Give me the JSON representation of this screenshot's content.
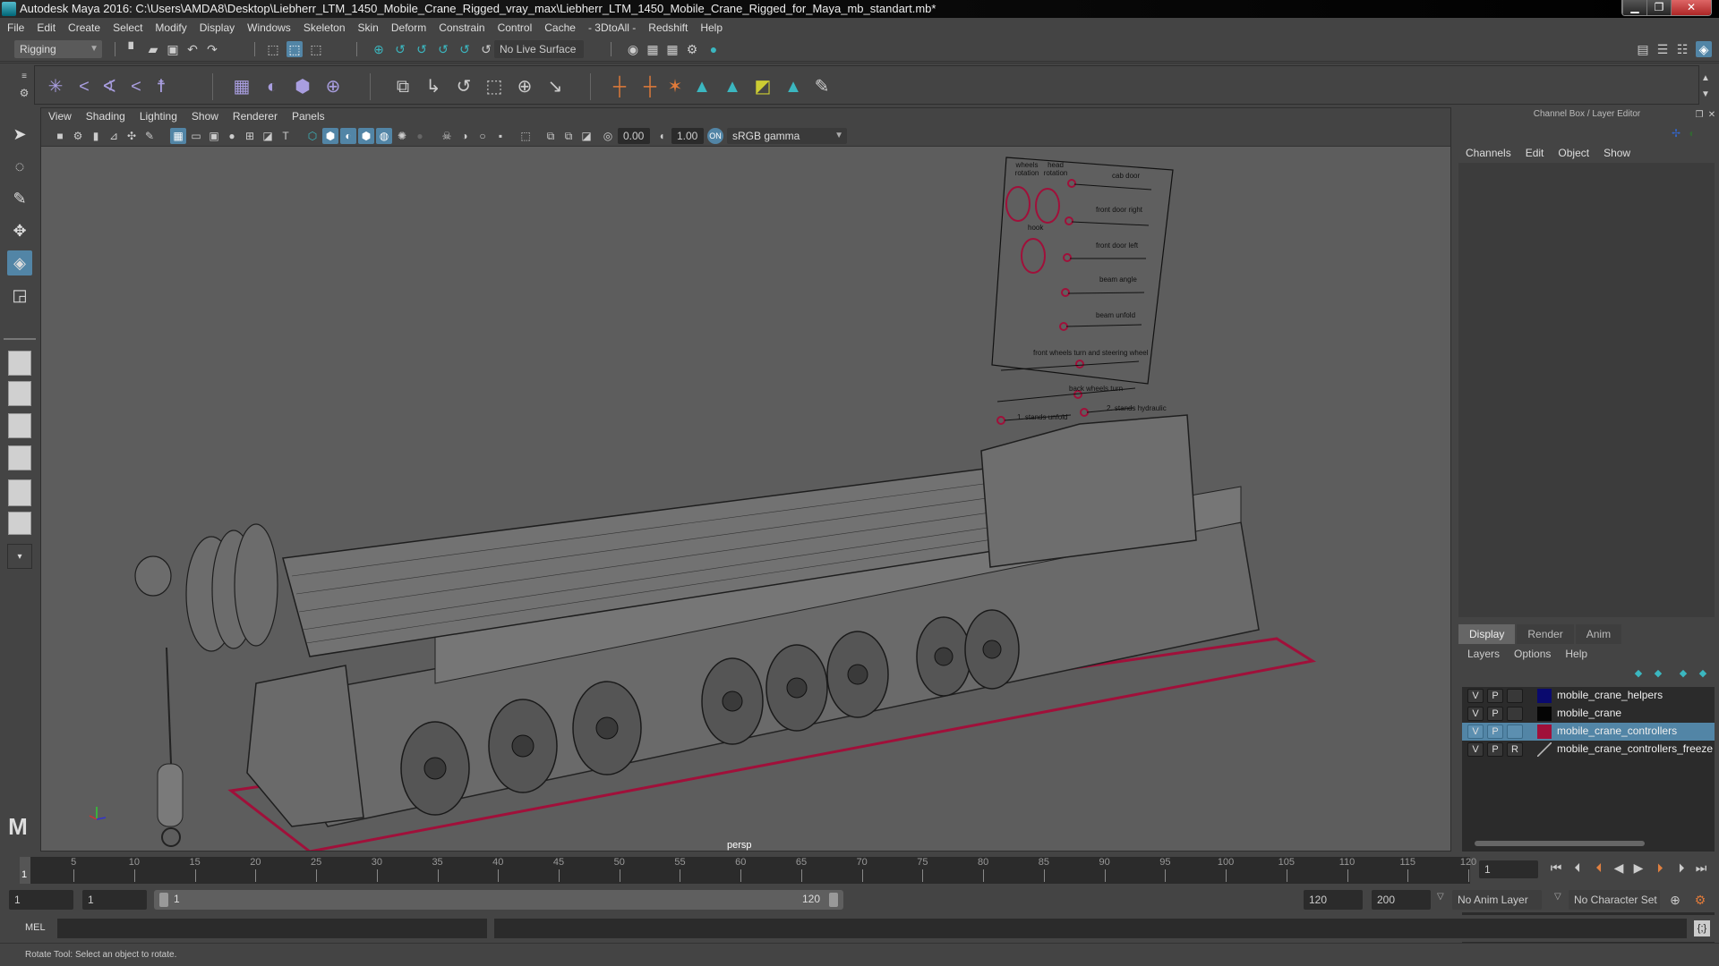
{
  "window": {
    "title": "Autodesk Maya 2016: C:\\Users\\AMDA8\\Desktop\\Liebherr_LTM_1450_Mobile_Crane_Rigged_vray_max\\Liebherr_LTM_1450_Mobile_Crane_Rigged_for_Maya_mb_standart.mb*",
    "minimize": "▁",
    "restore": "❐",
    "close": "✕"
  },
  "menubar": [
    "File",
    "Edit",
    "Create",
    "Select",
    "Modify",
    "Display",
    "Windows",
    "Skeleton",
    "Skin",
    "Deform",
    "Constrain",
    "Control",
    "Cache",
    "- 3DtoAll -",
    "Redshift",
    "Help"
  ],
  "statusline": {
    "menuset": "Rigging",
    "live_surface": "No Live Surface"
  },
  "panel": {
    "menus": [
      "View",
      "Shading",
      "Lighting",
      "Show",
      "Renderer",
      "Panels"
    ],
    "exposure": "0.00",
    "gamma": "1.00",
    "colorspace": "sRGB gamma",
    "camera_label": "persp"
  },
  "control_board": {
    "labels": [
      "wheels rotation",
      "head rotation",
      "hook",
      "cab door",
      "front door right",
      "front door left",
      "beam angle",
      "beam unfold",
      "front wheels turn and steering wheel",
      "back wheels turn",
      "1. stands unfold",
      "2. stands hydraulic"
    ]
  },
  "channelbox": {
    "header": "Channel Box / Layer Editor",
    "menus": [
      "Channels",
      "Edit",
      "Object",
      "Show"
    ]
  },
  "layer_editor": {
    "tabs": [
      "Display",
      "Render",
      "Anim"
    ],
    "active_tab": "Display",
    "menus": [
      "Layers",
      "Options",
      "Help"
    ],
    "layers": [
      {
        "v": "V",
        "p": "P",
        "r": "",
        "color": "#0a0a6e",
        "name": "mobile_crane_helpers",
        "selected": false
      },
      {
        "v": "V",
        "p": "P",
        "r": "",
        "color": "#050505",
        "name": "mobile_crane",
        "selected": false
      },
      {
        "v": "V",
        "p": "P",
        "r": "",
        "color": "#a0103a",
        "name": "mobile_crane_controllers",
        "selected": true
      },
      {
        "v": "V",
        "p": "P",
        "r": "R",
        "color": "none",
        "name": "mobile_crane_controllers_freeze",
        "selected": false
      }
    ]
  },
  "timeline": {
    "start": 1,
    "end": 120,
    "ticks": [
      5,
      10,
      15,
      20,
      25,
      30,
      35,
      40,
      45,
      50,
      55,
      60,
      65,
      70,
      75,
      80,
      85,
      90,
      95,
      100,
      105,
      110,
      115,
      120
    ],
    "current_frame_label": "1",
    "current_frame_field": "1"
  },
  "range": {
    "start_field": "1",
    "playback_start": "1",
    "range_start_label": "1",
    "range_end_label": "120",
    "playback_end": "120",
    "end_field": "200",
    "anim_layer": "No Anim Layer",
    "character_set": "No Character Set"
  },
  "cmdline": {
    "label": "MEL"
  },
  "helpline": {
    "text": "Rotate Tool: Select an object to rotate."
  },
  "colors": {
    "accent": "#5285a6",
    "controller": "#a0103a"
  }
}
